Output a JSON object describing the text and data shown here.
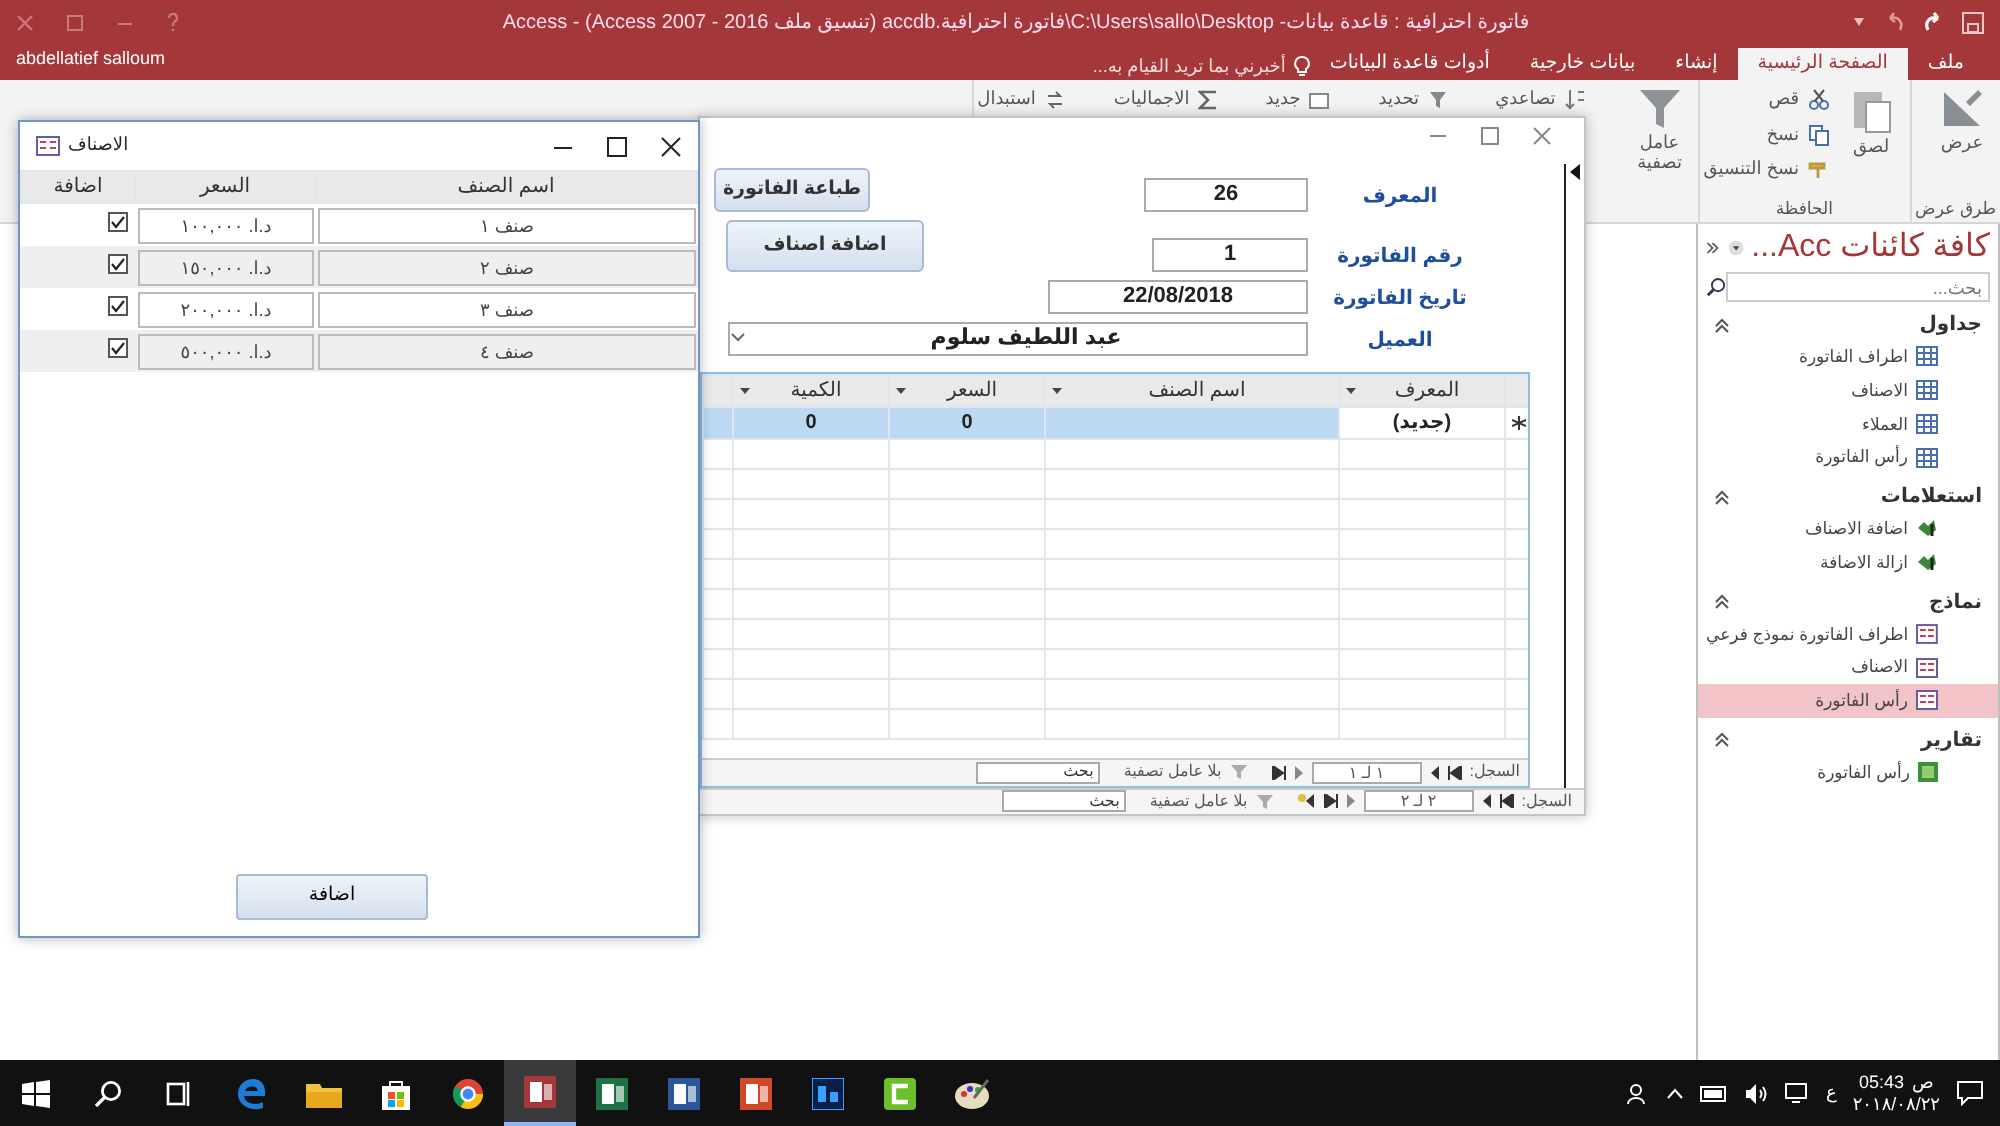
{
  "title_bar": {
    "title": "فاتورة احترافية : قاعدة بيانات- C:\\Users\\sallo\\Desktop\\فاتورة احترافية.accdb (تنسيق ملف Access 2007 - 2016) - Access",
    "user": "abdellatief salloum"
  },
  "ribbon_tabs": [
    {
      "label": "ملف",
      "selected": false
    },
    {
      "label": "الصفحة الرئيسية",
      "selected": true
    },
    {
      "label": "إنشاء",
      "selected": false
    },
    {
      "label": "بيانات خارجية",
      "selected": false
    },
    {
      "label": "أدوات قاعدة البيانات",
      "selected": false
    }
  ],
  "tell_me": {
    "placeholder": "أخبرني بما تريد القيام به..."
  },
  "ribbon_groups": [
    {
      "label": "طرق عرض",
      "commands": [
        {
          "label": "عرض",
          "kind": "view"
        }
      ]
    },
    {
      "label": "الحافظة",
      "commands": [
        {
          "label": "لصق",
          "kind": "paste"
        },
        {
          "label": "قص",
          "kind": "cut"
        },
        {
          "label": "نسخ",
          "kind": "copy"
        },
        {
          "label": "نسخ التنسيق",
          "kind": "format"
        }
      ]
    },
    {
      "commands": [
        {
          "label": "عامل تصفية",
          "kind": "filter"
        },
        {
          "label": "تصاعدي",
          "kind": "ascending"
        },
        {
          "label": "تحديد",
          "kind": "selection"
        },
        {
          "label": "جديد",
          "kind": "new"
        },
        {
          "label": "الاجماليات",
          "kind": "totals"
        },
        {
          "label": "استبدال",
          "kind": "replace"
        }
      ]
    }
  ],
  "nav_pane": {
    "title": "كافة كائنات Acc...",
    "search": {
      "placeholder": "بحث..."
    },
    "groups": [
      {
        "label": "جداول",
        "kind": "table",
        "items": [
          {
            "label": "اطراف الفاتورة",
            "selected": false
          },
          {
            "label": "الاصناف",
            "selected": false
          },
          {
            "label": "العملاء",
            "selected": false
          },
          {
            "label": "رأس الفاتورة",
            "selected": false
          }
        ]
      },
      {
        "label": "استعلامات",
        "kind": "query",
        "items": [
          {
            "label": "اضافة الاصناف",
            "selected": false
          },
          {
            "label": "ازالة الاضافة",
            "selected": false
          }
        ]
      },
      {
        "label": "نماذج",
        "kind": "form",
        "items": [
          {
            "label": "اطراف الفاتورة نموذج فرعي",
            "selected": false
          },
          {
            "label": "الاصناف",
            "selected": false
          },
          {
            "label": "رأس الفاتورة",
            "selected": true
          }
        ]
      },
      {
        "label": "تقارير",
        "kind": "report",
        "items": [
          {
            "label": "رأس الفاتورة",
            "selected": false
          }
        ]
      }
    ]
  },
  "invoice_form": {
    "buttons": [
      "طباعة الفاتورة",
      "اضافة اصناف"
    ],
    "fields": [
      {
        "label": "المعرف",
        "value": "26",
        "kind": "text"
      },
      {
        "label": "رقم الفاتورة",
        "value": "1",
        "kind": "text"
      },
      {
        "label": "تاريخ الفاتورة",
        "value": "22/08/2018",
        "kind": "text"
      },
      {
        "label": "العميل",
        "value": "عبد اللطيف سلوم",
        "kind": "combo"
      }
    ],
    "lines": {
      "columns": [
        "المعرف",
        "اسم الصنف",
        "السعر",
        "الكمية"
      ],
      "new_row": {
        "id": "(جديد)",
        "price": "0",
        "quantity": "0"
      },
      "nav": {
        "label": "السجل:",
        "position": "١ لـ ١",
        "filter": "بلا عامل تصفية",
        "search": {
          "placeholder": "بحث"
        }
      }
    },
    "nav": {
      "label": "السجل:",
      "position": "٢ لـ ٢",
      "filter": "بلا عامل تصفية",
      "search": {
        "placeholder": "بحث"
      }
    }
  },
  "items_window": {
    "title": "الاصناف",
    "columns": [
      "اسم الصنف",
      "السعر",
      "اضافة"
    ],
    "rows": [
      {
        "name": "صنف ١",
        "price": "د.ا. ١٠٠,٠٠٠",
        "checked": true
      },
      {
        "name": "صنف ٢",
        "price": "د.ا. ١٥٠,٠٠٠",
        "checked": true
      },
      {
        "name": "صنف ٣",
        "price": "د.ا. ٢٠٠,٠٠٠",
        "checked": true
      },
      {
        "name": "صنف ٤",
        "price": "د.ا. ٥٠٠,٠٠٠",
        "checked": true
      }
    ],
    "button": "اضافة"
  },
  "taskbar": {
    "apps": [
      {
        "kind": "start",
        "selected": false
      },
      {
        "kind": "search",
        "selected": false
      },
      {
        "kind": "taskview",
        "selected": false
      },
      {
        "kind": "edge",
        "selected": false
      },
      {
        "kind": "explorer",
        "selected": false
      },
      {
        "kind": "store",
        "selected": false
      },
      {
        "kind": "chrome",
        "selected": false
      },
      {
        "kind": "access",
        "selected": true
      },
      {
        "kind": "excel",
        "selected": false
      },
      {
        "kind": "word",
        "selected": false
      },
      {
        "kind": "powerpoint",
        "selected": false
      },
      {
        "kind": "photoshop",
        "selected": false
      },
      {
        "kind": "camtasia",
        "selected": false
      },
      {
        "kind": "paint",
        "selected": false
      }
    ],
    "language": "ع",
    "time": "05:43",
    "period": "ص",
    "date": "٢٠١٨/٠٨/٢٢"
  }
}
